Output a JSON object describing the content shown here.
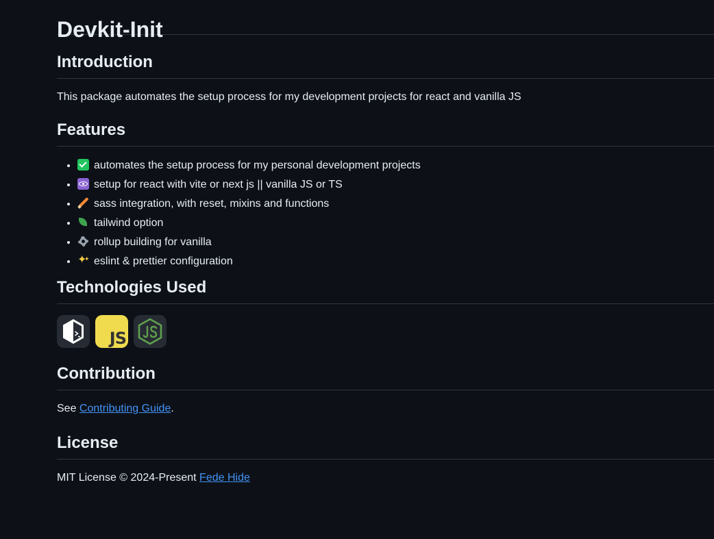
{
  "title": "Devkit-Init",
  "introduction": {
    "heading": "Introduction",
    "text": "This package automates the setup process for my development projects for react and vanilla JS"
  },
  "features": {
    "heading": "Features",
    "items": [
      {
        "icon": "check-mark-icon",
        "text": "automates the setup process for my personal development projects"
      },
      {
        "icon": "atom-icon",
        "text": "setup for react with vite or next js || vanilla JS or TS"
      },
      {
        "icon": "pencil-icon",
        "text": "sass integration, with reset, mixins and functions"
      },
      {
        "icon": "leaf-icon",
        "text": "tailwind option"
      },
      {
        "icon": "gear-icon",
        "text": "rollup building for vanilla"
      },
      {
        "icon": "sparkles-icon",
        "text": "eslint & prettier configuration"
      }
    ]
  },
  "technologies": {
    "heading": "Technologies Used",
    "icons": [
      {
        "name": "bash-icon",
        "color": "#272b33"
      },
      {
        "name": "javascript-icon",
        "label": "JS",
        "color": "#f0db4f"
      },
      {
        "name": "nodejs-icon",
        "color": "#272b33"
      }
    ]
  },
  "contribution": {
    "heading": "Contribution",
    "prefix": "See ",
    "link_text": "Contributing Guide",
    "suffix": "."
  },
  "license": {
    "heading": "License",
    "prefix": "MIT License © 2024-Present ",
    "link_text": "Fede Hide"
  },
  "colors": {
    "background": "#0d1117",
    "text": "#e6edf3",
    "link": "#4493f8",
    "divider": "#30363d"
  }
}
